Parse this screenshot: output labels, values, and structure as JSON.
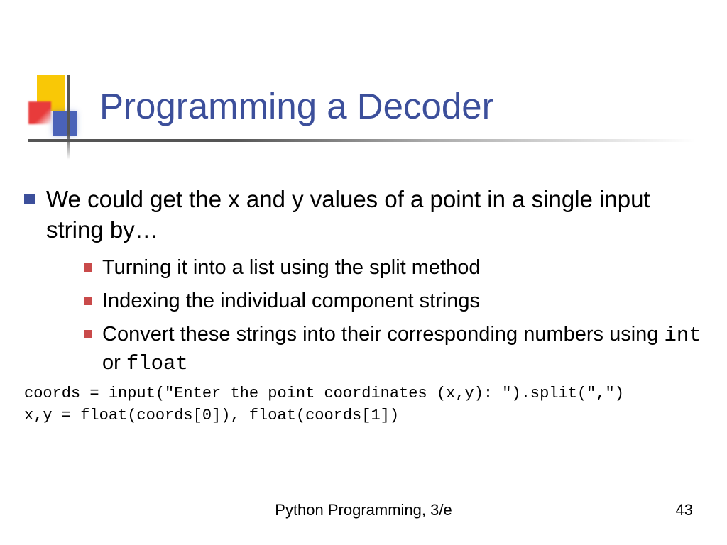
{
  "title": "Programming a Decoder",
  "main_bullet": "We could get the x and y values of a point in a single input string by…",
  "sub_bullets": [
    "Turning it into a list using the split method",
    "Indexing the individual component strings"
  ],
  "sub_bullet_3_prefix": "Convert these strings into their corresponding numbers using ",
  "sub_bullet_3_code1": "int",
  "sub_bullet_3_mid": " or ",
  "sub_bullet_3_code2": "float",
  "code_line1": "coords = input(\"Enter the point coordinates (x,y): \").split(\",\")",
  "code_line2": "x,y = float(coords[0]), float(coords[1])",
  "footer": "Python Programming, 3/e",
  "page": "43"
}
